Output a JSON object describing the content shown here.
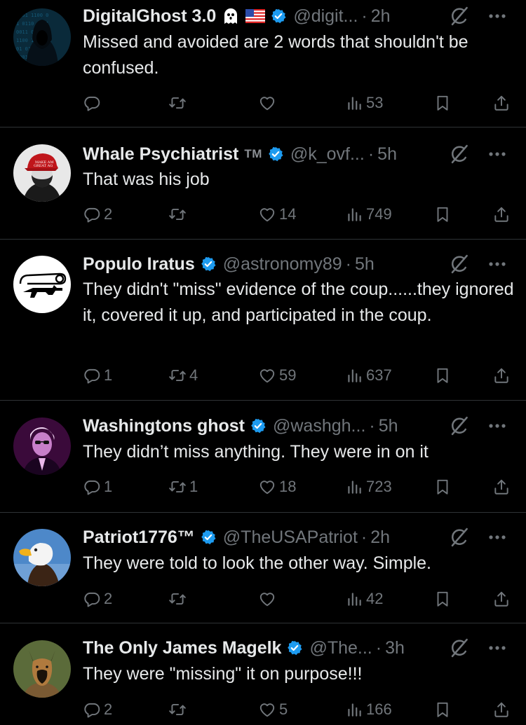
{
  "tweets": [
    {
      "name": "DigitalGhost 3.0",
      "emojis": [
        "ghost-emoji",
        "us-flag-emoji"
      ],
      "handle": "@digit...",
      "time": "2h",
      "text": "Missed and avoided are 2 words that shouldn't be confused.",
      "replies": "",
      "retweets": "",
      "likes": "",
      "views": "53",
      "avatar": "hooded-hacker"
    },
    {
      "name": "Whale Psychiatrist",
      "tm": "TM",
      "handle": "@k_ovf...",
      "time": "5h",
      "text": "That was his job",
      "replies": "2",
      "retweets": "",
      "likes": "14",
      "views": "749",
      "avatar": "red-cap-person"
    },
    {
      "name": "Populo Iratus",
      "handle": "@astronomy89",
      "time": "5h",
      "text": "They didn't \"miss\" evidence of the coup......they ignored it, covered it up, and participated in the coup.",
      "replies": "1",
      "retweets": "4",
      "likes": "59",
      "views": "637",
      "avatar": "safety-pin-rifle"
    },
    {
      "name": "Washingtons ghost",
      "handle": "@washgh...",
      "time": "5h",
      "text": "They didn’t miss anything. They were in on it",
      "replies": "1",
      "retweets": "1",
      "likes": "18",
      "views": "723",
      "avatar": "purple-portrait"
    },
    {
      "name": "Patriot1776™",
      "handle": "@TheUSAPatriot",
      "time": "2h",
      "text": "They were told to look the other way. Simple.",
      "replies": "2",
      "retweets": "",
      "likes": "",
      "views": "42",
      "avatar": "bald-eagle"
    },
    {
      "name": "The Only James Magelk",
      "handle": "@The...",
      "time": "3h",
      "text": "They were \"missing\" it on purpose!!!",
      "replies": "2",
      "retweets": "",
      "likes": "5",
      "views": "166",
      "avatar": "malinois-dog"
    }
  ],
  "colors": {
    "background": "#000000",
    "text": "#e7e9ea",
    "muted": "#71767b",
    "verified": "#1d9bf0",
    "divider": "#2f3336"
  }
}
